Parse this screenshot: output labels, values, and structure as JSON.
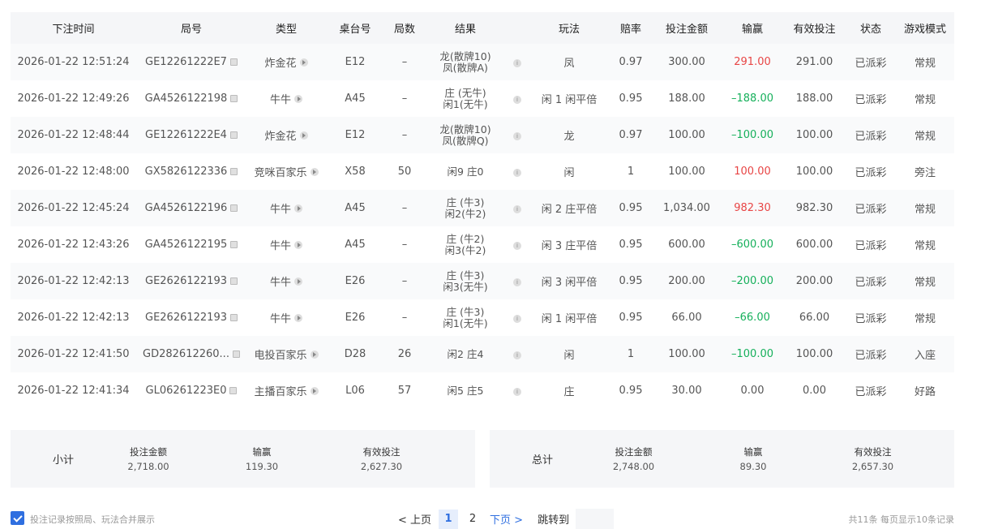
{
  "table": {
    "headers": [
      "下注时间",
      "局号",
      "类型",
      "桌台号",
      "局数",
      "结果",
      "玩法",
      "赔率",
      "投注金额",
      "输赢",
      "有效投注",
      "状态",
      "游戏模式"
    ],
    "rows": [
      {
        "time": "2026-01-22 12:51:24",
        "round_id": "GE12261222E7",
        "type": "炸金花",
        "table": "E12",
        "count": "–",
        "result1": "龙(散牌10)",
        "result2": "凤(散牌A)",
        "play": "凤",
        "odds": "0.97",
        "bet": "300.00",
        "winloss": "291.00",
        "wl_class": "win",
        "valid": "291.00",
        "status": "已派彩",
        "mode": "常规"
      },
      {
        "time": "2026-01-22 12:49:26",
        "round_id": "GA4526122198",
        "type": "牛牛",
        "table": "A45",
        "count": "–",
        "result1": "庄 (无牛)",
        "result2": "闲1(无牛)",
        "play": "闲 1 闲平倍",
        "odds": "0.95",
        "bet": "188.00",
        "winloss": "–188.00",
        "wl_class": "lose",
        "valid": "188.00",
        "status": "已派彩",
        "mode": "常规"
      },
      {
        "time": "2026-01-22 12:48:44",
        "round_id": "GE12261222E4",
        "type": "炸金花",
        "table": "E12",
        "count": "–",
        "result1": "龙(散牌10)",
        "result2": "凤(散牌Q)",
        "play": "龙",
        "odds": "0.97",
        "bet": "100.00",
        "winloss": "–100.00",
        "wl_class": "lose",
        "valid": "100.00",
        "status": "已派彩",
        "mode": "常规"
      },
      {
        "time": "2026-01-22 12:48:00",
        "round_id": "GX5826122336",
        "type": "竞咪百家乐",
        "table": "X58",
        "count": "50",
        "result1": "闲9 庄0",
        "result2": "",
        "play": "闲",
        "odds": "1",
        "bet": "100.00",
        "winloss": "100.00",
        "wl_class": "win",
        "valid": "100.00",
        "status": "已派彩",
        "mode": "旁注"
      },
      {
        "time": "2026-01-22 12:45:24",
        "round_id": "GA4526122196",
        "type": "牛牛",
        "table": "A45",
        "count": "–",
        "result1": "庄 (牛3)",
        "result2": "闲2(牛2)",
        "play": "闲 2 庄平倍",
        "odds": "0.95",
        "bet": "1,034.00",
        "winloss": "982.30",
        "wl_class": "win",
        "valid": "982.30",
        "status": "已派彩",
        "mode": "常规"
      },
      {
        "time": "2026-01-22 12:43:26",
        "round_id": "GA4526122195",
        "type": "牛牛",
        "table": "A45",
        "count": "–",
        "result1": "庄 (牛2)",
        "result2": "闲3(牛2)",
        "play": "闲 3 庄平倍",
        "odds": "0.95",
        "bet": "600.00",
        "winloss": "–600.00",
        "wl_class": "lose",
        "valid": "600.00",
        "status": "已派彩",
        "mode": "常规"
      },
      {
        "time": "2026-01-22 12:42:13",
        "round_id": "GE2626122193",
        "type": "牛牛",
        "table": "E26",
        "count": "–",
        "result1": "庄 (牛3)",
        "result2": "闲3(无牛)",
        "play": "闲 3 闲平倍",
        "odds": "0.95",
        "bet": "200.00",
        "winloss": "–200.00",
        "wl_class": "lose",
        "valid": "200.00",
        "status": "已派彩",
        "mode": "常规"
      },
      {
        "time": "2026-01-22 12:42:13",
        "round_id": "GE2626122193",
        "type": "牛牛",
        "table": "E26",
        "count": "–",
        "result1": "庄 (牛3)",
        "result2": "闲1(无牛)",
        "play": "闲 1 闲平倍",
        "odds": "0.95",
        "bet": "66.00",
        "winloss": "–66.00",
        "wl_class": "lose",
        "valid": "66.00",
        "status": "已派彩",
        "mode": "常规"
      },
      {
        "time": "2026-01-22 12:41:50",
        "round_id": "GD282612260...",
        "type": "电投百家乐",
        "table": "D28",
        "count": "26",
        "result1": "闲2 庄4",
        "result2": "",
        "play": "闲",
        "odds": "1",
        "bet": "100.00",
        "winloss": "–100.00",
        "wl_class": "lose",
        "valid": "100.00",
        "status": "已派彩",
        "mode": "入座"
      },
      {
        "time": "2026-01-22 12:41:34",
        "round_id": "GL06261223E0",
        "type": "主播百家乐",
        "table": "L06",
        "count": "57",
        "result1": "闲5 庄5",
        "result2": "",
        "play": "庄",
        "odds": "0.95",
        "bet": "30.00",
        "winloss": "0.00",
        "wl_class": "",
        "valid": "0.00",
        "status": "已派彩",
        "mode": "好路"
      }
    ]
  },
  "subtotal": {
    "title": "小计",
    "bet_label": "投注金额",
    "bet": "2,718.00",
    "wl_label": "输赢",
    "wl": "119.30",
    "valid_label": "有效投注",
    "valid": "2,627.30"
  },
  "total": {
    "title": "总计",
    "bet_label": "投注金额",
    "bet": "2,748.00",
    "wl_label": "输赢",
    "wl": "89.30",
    "valid_label": "有效投注",
    "valid": "2,657.30"
  },
  "footer": {
    "merge_label": "投注记录按照局、玩法合并展示",
    "prev": "< 上页",
    "pages": [
      "1",
      "2"
    ],
    "next": "下页 >",
    "jump": "跳转到",
    "info": "共11条  每页显示10条记录"
  },
  "colors": {
    "win": "#e84545",
    "lose": "#16b05b",
    "accent": "#2f6fe0"
  }
}
